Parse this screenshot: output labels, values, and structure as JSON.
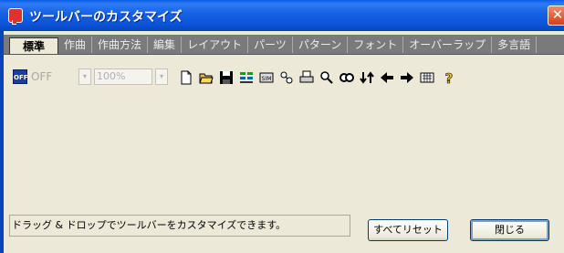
{
  "window": {
    "title": "ツールバーのカスタマイズ",
    "close_glyph": "✕"
  },
  "tabs": [
    {
      "label": "標準",
      "active": true
    },
    {
      "label": "作曲"
    },
    {
      "label": "作曲方法"
    },
    {
      "label": "編集"
    },
    {
      "label": "レイアウト"
    },
    {
      "label": "パーツ"
    },
    {
      "label": "パターン"
    },
    {
      "label": "フォント"
    },
    {
      "label": "オーバーラップ"
    },
    {
      "label": "多言語"
    }
  ],
  "toolbar": {
    "off_icon_text": "OFF",
    "off_label": "OFF",
    "dropdown_arrow": "▾",
    "zoom_value": "100%",
    "icons": [
      "new-document-icon",
      "open-folder-icon",
      "save-disk-icon",
      "score-layout-icon",
      "sim-icon",
      "parts-icon",
      "print-icon",
      "zoom-icon",
      "view-double-icon",
      "transpose-icon",
      "arrow-left-icon",
      "arrow-right-icon",
      "keyboard-icon",
      "help-icon"
    ]
  },
  "status": {
    "message": "ドラッグ & ドロップでツールバーをカスタマイズできます。"
  },
  "buttons": {
    "reset_all": "すべてリセット",
    "close": "閉じる"
  },
  "colors": {
    "titlebar": "#0b53d8",
    "tabstrip": "#7a7a7a",
    "window_bg": "#ece9d8"
  }
}
